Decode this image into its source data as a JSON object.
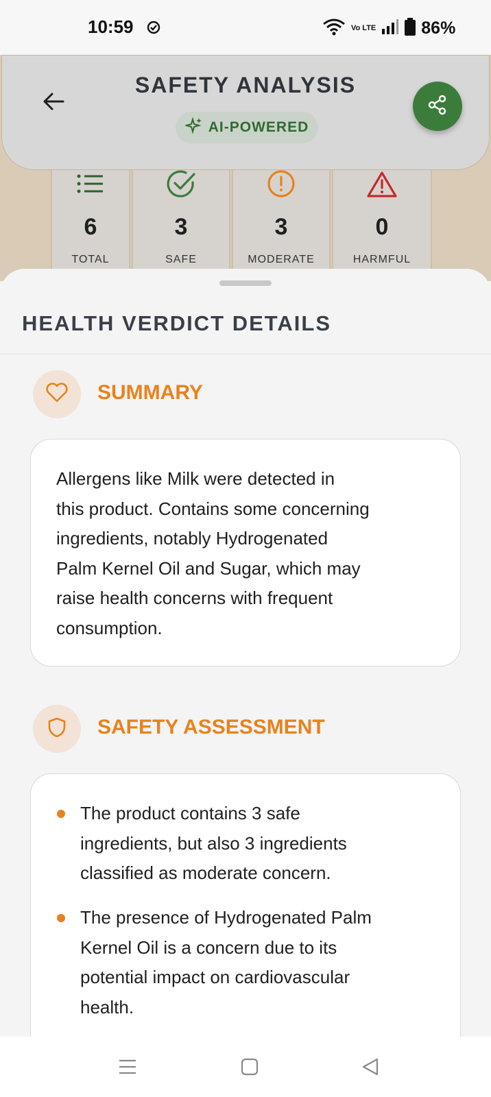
{
  "status": {
    "time": "10:59",
    "battery": "86%",
    "network": "Vo LTE"
  },
  "header": {
    "title": "SAFETY ANALYSIS",
    "badge": "AI-POWERED"
  },
  "stats": [
    {
      "value": "6",
      "label": "TOTAL",
      "icon": "list-icon",
      "color": "#2f5f2f"
    },
    {
      "value": "3",
      "label": "SAFE",
      "icon": "check-circle-icon",
      "color": "#3b7c3b"
    },
    {
      "value": "3",
      "label": "MODERATE",
      "icon": "alert-circle-icon",
      "color": "#e8821c"
    },
    {
      "value": "0",
      "label": "HARMFUL",
      "icon": "warning-triangle-icon",
      "color": "#c62828"
    }
  ],
  "sheet": {
    "title": "HEALTH VERDICT DETAILS",
    "summary": {
      "heading": "SUMMARY",
      "lines": [
        "Allergens like Milk were detected in",
        "this product. Contains some concerning",
        "ingredients, notably Hydrogenated",
        "Palm Kernel Oil and Sugar, which may",
        "raise health concerns with frequent",
        "consumption."
      ]
    },
    "safety": {
      "heading": "SAFETY ASSESSMENT",
      "bullets": [
        {
          "lines": [
            "The product contains 3 safe",
            "ingredients, but also 3 ingredients",
            "classified as moderate concern."
          ]
        },
        {
          "lines": [
            "The presence of Hydrogenated Palm",
            "Kernel Oil is a concern due to its",
            "potential impact on cardiovascular",
            "health."
          ]
        }
      ]
    }
  },
  "colors": {
    "accent": "#e8821c",
    "safe": "#3b7c3b",
    "harmful": "#c62828"
  }
}
